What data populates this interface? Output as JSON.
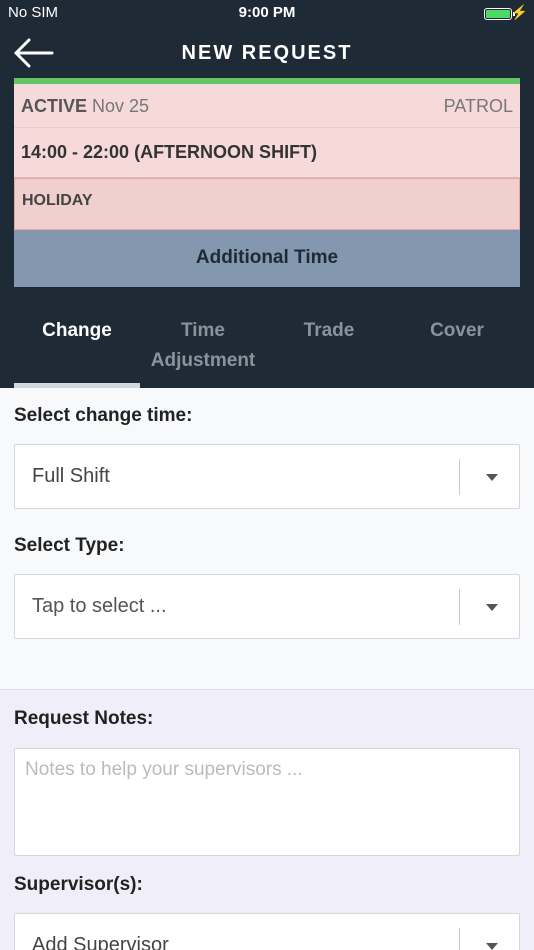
{
  "status_bar": {
    "carrier": "No SIM",
    "time": "9:00 PM",
    "battery_color": "#4cd964"
  },
  "nav": {
    "title": "NEW REQUEST",
    "back_icon": "arrow-left-icon"
  },
  "shift": {
    "status": "ACTIVE",
    "date": "Nov 25",
    "unit": "PATROL",
    "time_range": "14:00 - 22:00 (AFTERNOON SHIFT)",
    "type": "HOLIDAY",
    "additional_label": "Additional Time",
    "status_color": "#65c466"
  },
  "tabs": [
    {
      "label": "Change",
      "active": true
    },
    {
      "label": "Time Adjustment",
      "active": false
    },
    {
      "label": "Trade",
      "active": false
    },
    {
      "label": "Cover",
      "active": false
    }
  ],
  "form": {
    "change_time_label": "Select change time:",
    "change_time_value": "Full Shift",
    "type_label": "Select Type:",
    "type_placeholder": "Tap to select ...",
    "notes_label": "Request Notes:",
    "notes_placeholder": "Notes to help your supervisors ...",
    "supervisors_label": "Supervisor(s):",
    "supervisor_placeholder": "Add Supervisor"
  },
  "colors": {
    "header_bg": "#1e2a36",
    "card_bg": "#f6dada",
    "additional_bg": "#8397ae",
    "lower_bg": "#efeef9"
  }
}
